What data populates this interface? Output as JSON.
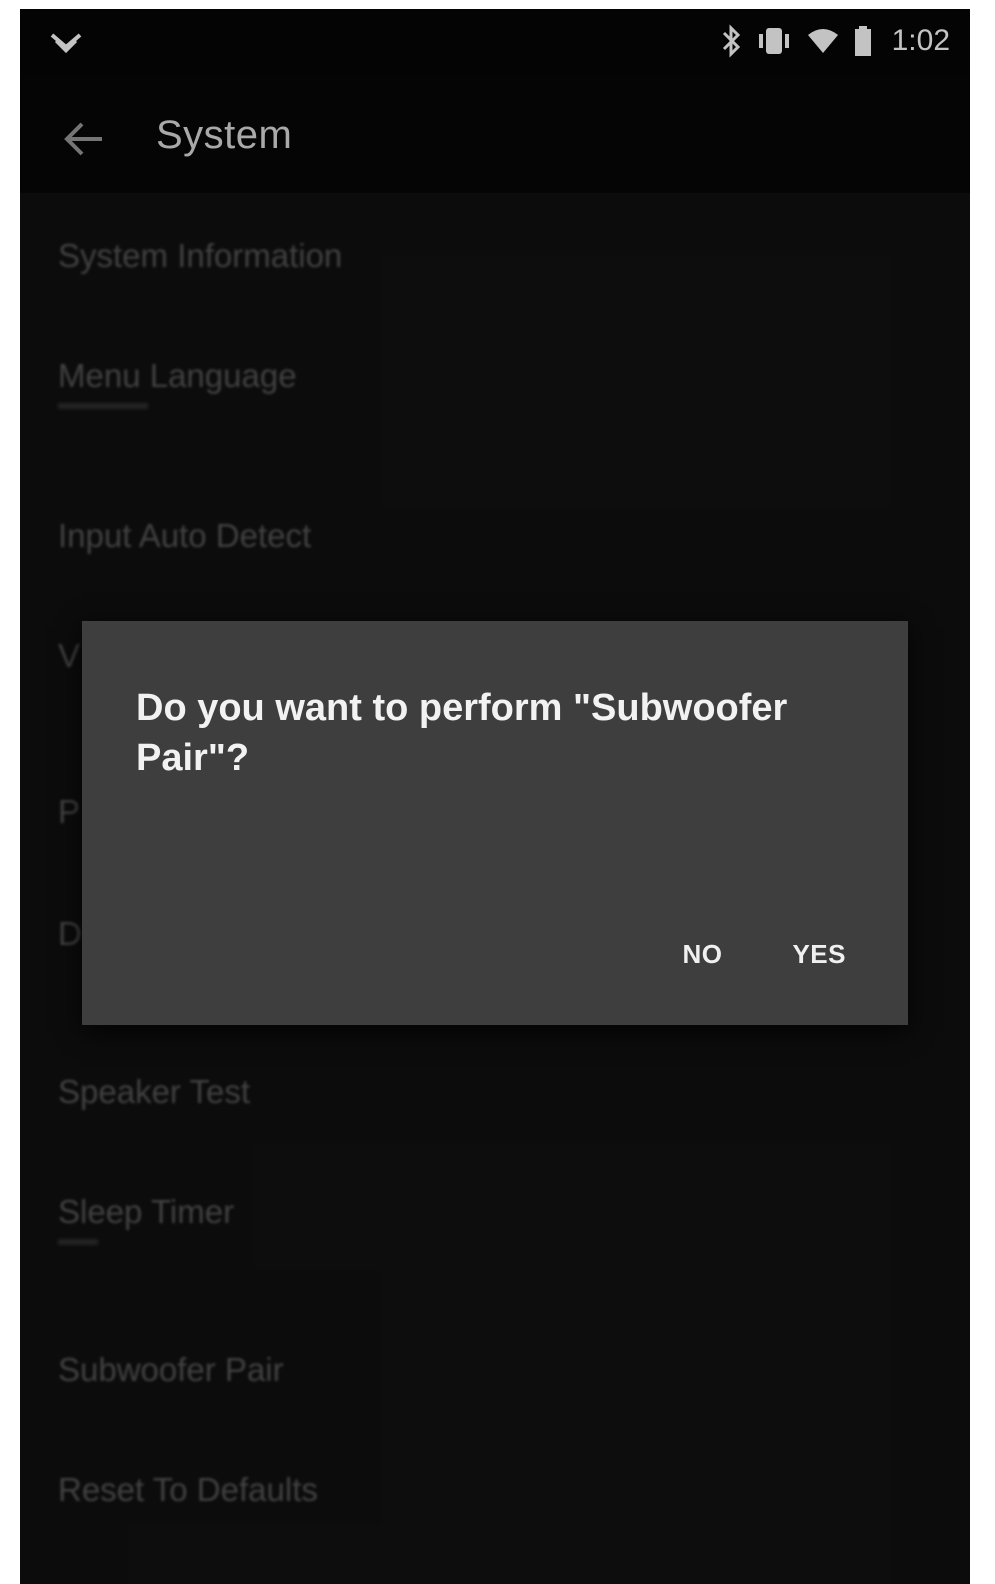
{
  "status_bar": {
    "time": "1:02",
    "icons": [
      "notification-dropdown-icon",
      "bluetooth-icon",
      "vibrate-icon",
      "wifi-icon",
      "battery-icon"
    ]
  },
  "app_bar": {
    "title": "System",
    "back_icon": "arrow-back-icon"
  },
  "settings": {
    "items": [
      {
        "label": "System Information"
      },
      {
        "label": "Menu Language"
      },
      {
        "label": "Input Auto Detect"
      },
      {
        "label": "V"
      },
      {
        "label": "P"
      },
      {
        "label": "D"
      },
      {
        "label": "Speaker Test"
      },
      {
        "label": "Sleep Timer"
      },
      {
        "label": "Subwoofer Pair"
      },
      {
        "label": "Reset To Defaults"
      }
    ]
  },
  "dialog": {
    "message": "Do you want to perform \"Subwoofer Pair\"?",
    "no_label": "NO",
    "yes_label": "YES"
  },
  "colors": {
    "background": "#0c0c0c",
    "dialog": "#3e3e3e",
    "text_primary": "#f2f2f2"
  }
}
